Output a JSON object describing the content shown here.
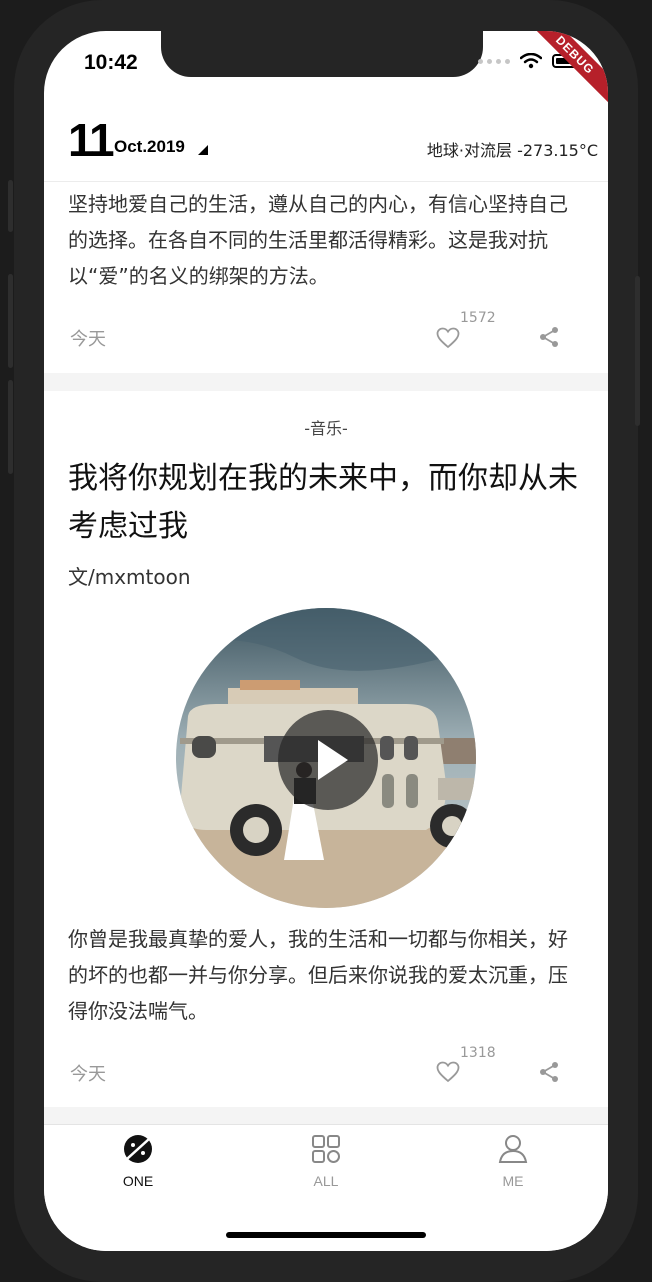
{
  "status_bar": {
    "time": "10:42",
    "debug_label": "DEBUG"
  },
  "header": {
    "day": "11",
    "month_year": "Oct.2019",
    "weather": "地球·对流层 -273.15°C"
  },
  "card1": {
    "body": "坚持地爱自己的生活，遵从自己的内心，有信心坚持自己的选择。在各自不同的生活里都活得精彩。这是我对抗以“爱”的名义的绑架的方法。",
    "date": "今天",
    "likes": "1572"
  },
  "card2": {
    "category": "-音乐-",
    "title": "我将你规划在我的未来中，而你却从未考虑过我",
    "author": "文/mxmtoon",
    "body": "你曾是我最真挚的爱人，我的生活和一切都与你相关，好的坏的也都一并与你分享。但后来你说我的爱太沉重，压得你没法喘气。",
    "date": "今天",
    "likes": "1318"
  },
  "tabbar": {
    "tabs": [
      {
        "label": "ONE",
        "icon": "one-icon",
        "active": true
      },
      {
        "label": "ALL",
        "icon": "grid-icon",
        "active": false
      },
      {
        "label": "ME",
        "icon": "person-icon",
        "active": false
      }
    ]
  },
  "colors": {
    "active_tab": "#111111",
    "inactive_tab": "#999999",
    "debug_banner": "#b6202a",
    "muted_text": "#999999"
  }
}
